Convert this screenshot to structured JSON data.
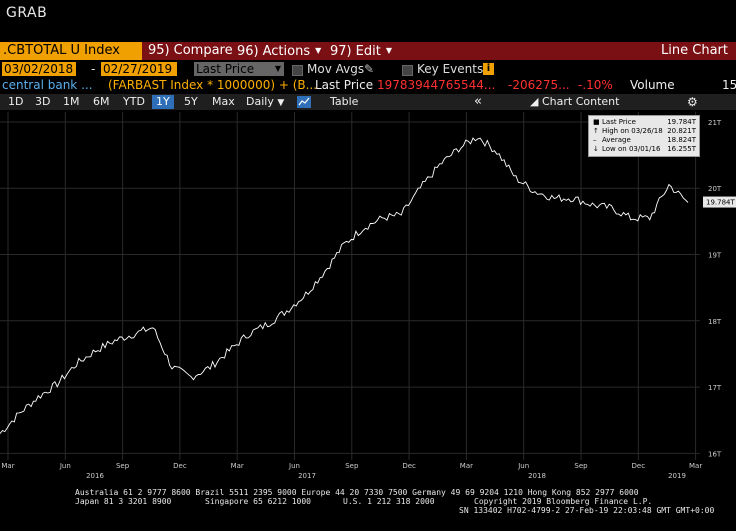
{
  "window": {
    "title": "GRAB"
  },
  "titlebar": {
    "ticker": ".CBTOTAL U Index",
    "menus": [
      {
        "num": "95)",
        "label": "Compare",
        "caret": false
      },
      {
        "num": "96)",
        "label": "Actions",
        "caret": true
      },
      {
        "num": "97)",
        "label": "Edit",
        "caret": true
      }
    ],
    "chart_type": "Line Chart"
  },
  "controls": {
    "start_date": "03/02/2018",
    "dash": "-",
    "end_date": "02/27/2019",
    "field": "Last Price",
    "mov_avgs": "Mov Avgs",
    "key_events": "Key Events",
    "info": "i"
  },
  "security_line": {
    "name": "central bank ...",
    "formula": "(FARBAST Index * 1000000) + (B...",
    "last_price_label": "Last Price",
    "last_price_value": "19783944765544...",
    "change": "-206275...",
    "change_pct": "-.10%",
    "volume_label": "Volume",
    "volume_value": "15"
  },
  "toolbar": {
    "ranges": [
      "1D",
      "3D",
      "1M",
      "6M",
      "YTD",
      "1Y",
      "5Y",
      "Max"
    ],
    "active_range": "1Y",
    "frequency": "Daily",
    "table": "Table",
    "nav": "«",
    "chart_content": "Chart Content",
    "settings_icon": "gear-icon"
  },
  "chart_data": {
    "type": "line",
    "series": [
      {
        "name": "Last Price",
        "x": [
          "2016-02",
          "2016-03",
          "2016-04",
          "2016-05",
          "2016-06",
          "2016-07",
          "2016-08",
          "2016-09",
          "2016-10",
          "2016-11",
          "2016-12",
          "2017-01",
          "2017-02",
          "2017-03",
          "2017-04",
          "2017-05",
          "2017-06",
          "2017-07",
          "2017-08",
          "2017-09",
          "2017-10",
          "2017-11",
          "2017-12",
          "2018-01",
          "2018-02",
          "2018-03",
          "2018-04",
          "2018-05",
          "2018-06",
          "2018-07",
          "2018-08",
          "2018-09",
          "2018-10",
          "2018-11",
          "2018-12",
          "2019-01",
          "2019-02"
        ],
        "values": [
          16.3,
          16.6,
          16.85,
          17.05,
          17.35,
          17.55,
          17.7,
          17.8,
          17.9,
          17.3,
          17.15,
          17.3,
          17.55,
          17.8,
          17.95,
          18.15,
          18.4,
          18.75,
          19.15,
          19.4,
          19.55,
          19.6,
          20.0,
          20.35,
          20.6,
          20.78,
          20.55,
          20.15,
          19.95,
          19.85,
          19.85,
          19.75,
          19.7,
          19.55,
          19.55,
          20.05,
          19.784
        ]
      }
    ],
    "y_ticks": [
      "21T",
      "20T",
      "19T",
      "18T",
      "17T",
      "16T"
    ],
    "y_tick_values": [
      21,
      20,
      19,
      18,
      17,
      16
    ],
    "ylim": [
      15.9,
      21.15
    ],
    "x_month_ticks": [
      "Mar",
      "Jun",
      "Sep",
      "Dec",
      "Mar",
      "Jun",
      "Sep",
      "Dec",
      "Mar",
      "Jun",
      "Sep",
      "Dec",
      "Mar"
    ],
    "x_year_labels": [
      "2016",
      "2017",
      "2018",
      "2019"
    ],
    "last_value_label": "19.784T",
    "grid": true,
    "legend": {
      "placement": "top-right",
      "entries": [
        {
          "label": "Last Price",
          "value": "19.784T"
        },
        {
          "label": "High on 03/26/18",
          "value": "20.821T"
        },
        {
          "label": "Average",
          "value": "18.824T"
        },
        {
          "label": "Low on 03/01/16",
          "value": "16.255T"
        }
      ]
    },
    "colors": {
      "line": "#ffffff",
      "background": "#000000",
      "grid": "#2a2a2a"
    }
  },
  "footer": {
    "line1": "Australia 61 2 9777 8600 Brazil 5511 2395 9000 Europe 44 20 7330 7500 Germany 49 69 9204 1210 Hong Kong 852 2977 6000",
    "line2a": "Japan 81 3 3201 8900",
    "line2b": "Singapore 65 6212 1000",
    "line2c": "U.S. 1 212 318 2000",
    "line2d": "Copyright 2019 Bloomberg Finance L.P.",
    "line3": "SN 133402 H702-4799-2 27-Feb-19 22:03:48 GMT GMT+0:00"
  }
}
